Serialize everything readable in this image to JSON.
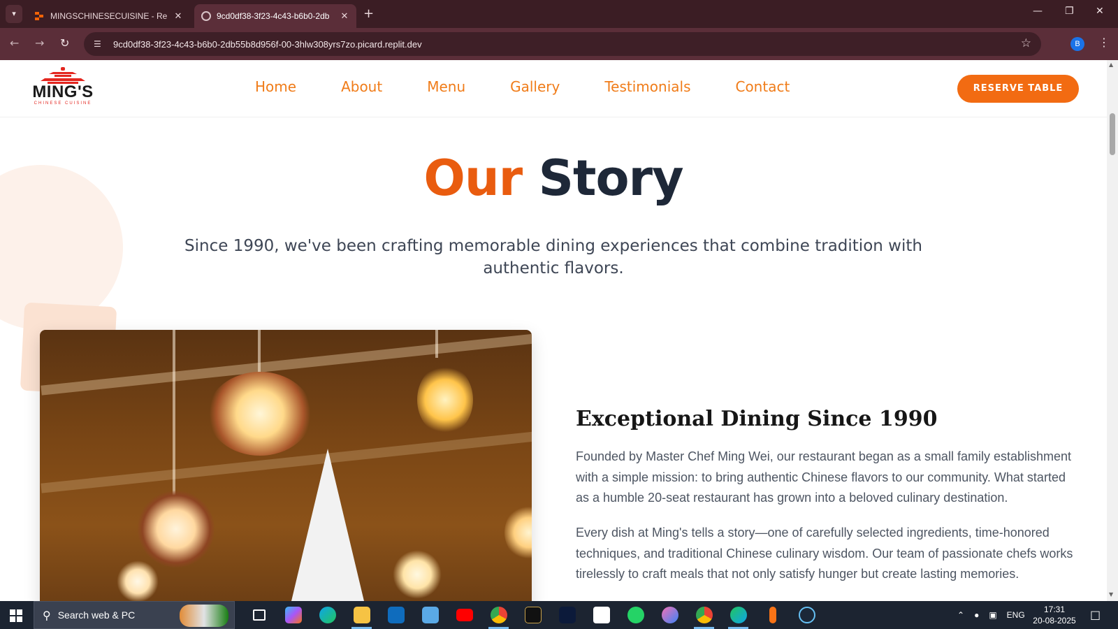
{
  "browser": {
    "tabs": [
      {
        "title": "MINGSCHINESECUISINE - Replit",
        "active": false
      },
      {
        "title": "9cd0df38-3f23-4c43-b6b0-2db",
        "active": true
      }
    ],
    "new_tab_label": "+",
    "url": "9cd0df38-3f23-4c43-b6b0-2db55b8d956f-00-3hlw308yrs7zo.picard.replit.dev",
    "profile_initial": "B"
  },
  "site": {
    "logo": {
      "name": "MING'S",
      "tagline": "CHINESE CUISINE"
    },
    "nav": [
      "Home",
      "About",
      "Menu",
      "Gallery",
      "Testimonials",
      "Contact"
    ],
    "cta": "RESERVE TABLE",
    "story": {
      "title_accent": "Our",
      "title_main": "Story",
      "subtitle": "Since 1990, we've been crafting memorable dining experiences that combine tradition with authentic flavors.",
      "heading": "Exceptional Dining Since 1990",
      "paragraphs": [
        "Founded by Master Chef Ming Wei, our restaurant began as a small family establishment with a simple mission: to bring authentic Chinese flavors to our community. What started as a humble 20-seat restaurant has grown into a beloved culinary destination.",
        "Every dish at Ming's tells a story—one of carefully selected ingredients, time-honored techniques, and traditional Chinese culinary wisdom. Our team of passionate chefs works tirelessly to craft meals that not only satisfy hunger but create lasting memories."
      ]
    }
  },
  "colors": {
    "accent": "#e95c0f",
    "button": "#f26b12",
    "nav": "#f07c19",
    "dark": "#1e2838",
    "chrome": "#3b1d24"
  },
  "taskbar": {
    "search_placeholder": "Search web & PC",
    "apps": [
      "task-view-icon",
      "copilot-icon",
      "edge-icon",
      "file-explorer-icon",
      "outlook-icon",
      "control-panel-icon",
      "youtube-icon",
      "chrome-a-icon",
      "sonyliv-icon",
      "hotstar-icon",
      "capcut-icon",
      "whatsapp-icon",
      "snipping-icon",
      "chrome-b-icon",
      "edge-dev-icon",
      "microphone-icon",
      "steam-icon"
    ],
    "language": "ENG",
    "time": "17:31",
    "date": "20-08-2025"
  }
}
